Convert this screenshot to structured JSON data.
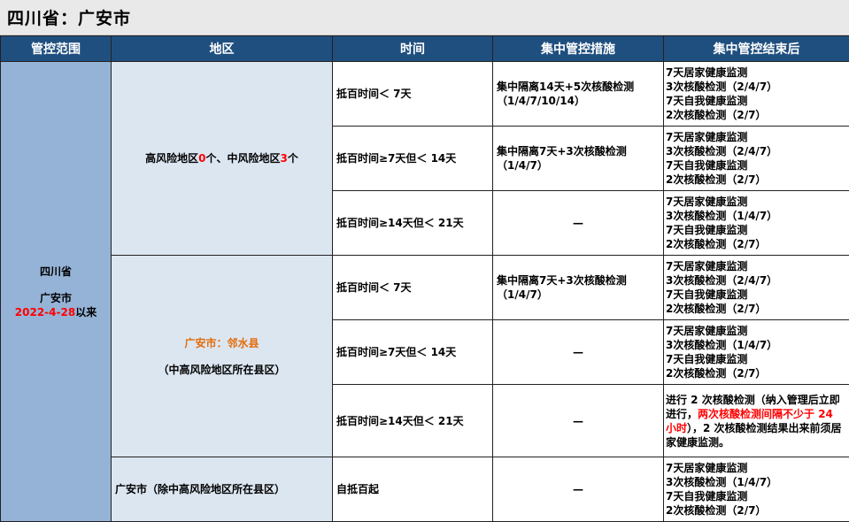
{
  "title": "四川省：广安市",
  "headers": [
    "管控范围",
    "地区",
    "时间",
    "集中管控措施",
    "集中管控结束后"
  ],
  "scope": {
    "province": "四川省",
    "city": "广安市",
    "date": "2022-4-28",
    "since": "以来"
  },
  "region1": {
    "a": "高风险地区",
    "b": "0",
    "c": "个、中风险地区",
    "d": "3",
    "e": "个"
  },
  "region2": {
    "name": "广安市：邻水县",
    "note": "（中高风险地区所在县区）"
  },
  "region3": "广安市（除中高风险地区所在县区）",
  "rows": [
    {
      "time": "抵百时间＜ 7天",
      "measure": [
        "集中隔离14天+5次核酸检测",
        "（1/4/7/10/14）"
      ],
      "after": [
        "7天居家健康监测",
        "3次核酸检测（2/4/7）",
        "7天自我健康监测",
        "2次核酸检测（2/7）"
      ]
    },
    {
      "time": "抵百时间≥7天但＜ 14天",
      "measure": [
        "集中隔离7天+3次核酸检测",
        "（1/4/7）"
      ],
      "after": [
        "7天居家健康监测",
        "3次核酸检测（2/4/7）",
        "7天自我健康监测",
        "2次核酸检测（2/7）"
      ]
    },
    {
      "time": "抵百时间≥14天但＜ 21天",
      "measure": [
        "—"
      ],
      "after": [
        "7天居家健康监测",
        "3次核酸检测（1/4/7）",
        "7天自我健康监测",
        "2次核酸检测（2/7）"
      ]
    },
    {
      "time": "抵百时间＜ 7天",
      "measure": [
        "集中隔离7天+3次核酸检测",
        "（1/4/7）"
      ],
      "after": [
        "7天居家健康监测",
        "3次核酸检测（2/4/7）",
        "7天自我健康监测",
        "2次核酸检测（2/7）"
      ]
    },
    {
      "time": "抵百时间≥7天但＜ 14天",
      "measure": [
        "—"
      ],
      "after": [
        "7天居家健康监测",
        "3次核酸检测（1/4/7）",
        "7天自我健康监测",
        "2次核酸检测（2/7）"
      ]
    },
    {
      "time": "抵百时间≥14天但＜ 21天",
      "measure": [
        "—"
      ],
      "after_rich": {
        "p1": "进行 2 次核酸检测（纳入管理后立即进行，",
        "red": "两次核酸检测间隔不少于 24 小时",
        "p2": "），2 次核酸检测结果出来前须居家健康监测。"
      }
    },
    {
      "time": "自抵百起",
      "measure": [
        "—"
      ],
      "after": [
        "7天居家健康监测",
        "3次核酸检测（1/4/7）",
        "7天自我健康监测",
        "2次核酸检测（2/7）"
      ]
    }
  ]
}
